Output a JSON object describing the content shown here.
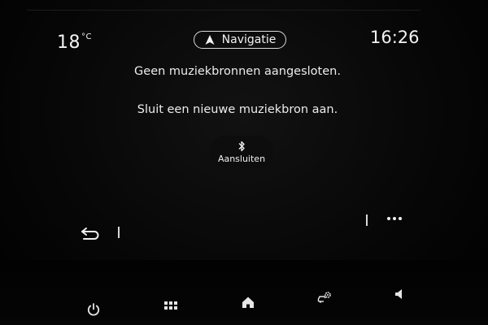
{
  "status_bar": {
    "temperature": "18",
    "temperature_unit": "°C",
    "navigation_label": "Navigatie",
    "time": "16:26"
  },
  "content": {
    "message_primary": "Geen muziekbronnen aangesloten.",
    "message_secondary": "Sluit een nieuwe muziekbron aan.",
    "connect_button_label": "Aansluiten",
    "connect_icon": "bluetooth-icon"
  },
  "toolbar": {
    "back_icon": "back-arrow-icon",
    "more_icon": "more-dots-icon"
  },
  "bottom_bar": {
    "items": [
      {
        "icon": "power-icon"
      },
      {
        "icon": "apps-grid-icon"
      },
      {
        "icon": "home-icon"
      },
      {
        "icon": "vehicle-settings-icon"
      },
      {
        "icon": "volume-icon"
      }
    ]
  },
  "colors": {
    "background": "#000000",
    "text": "#ececec"
  }
}
